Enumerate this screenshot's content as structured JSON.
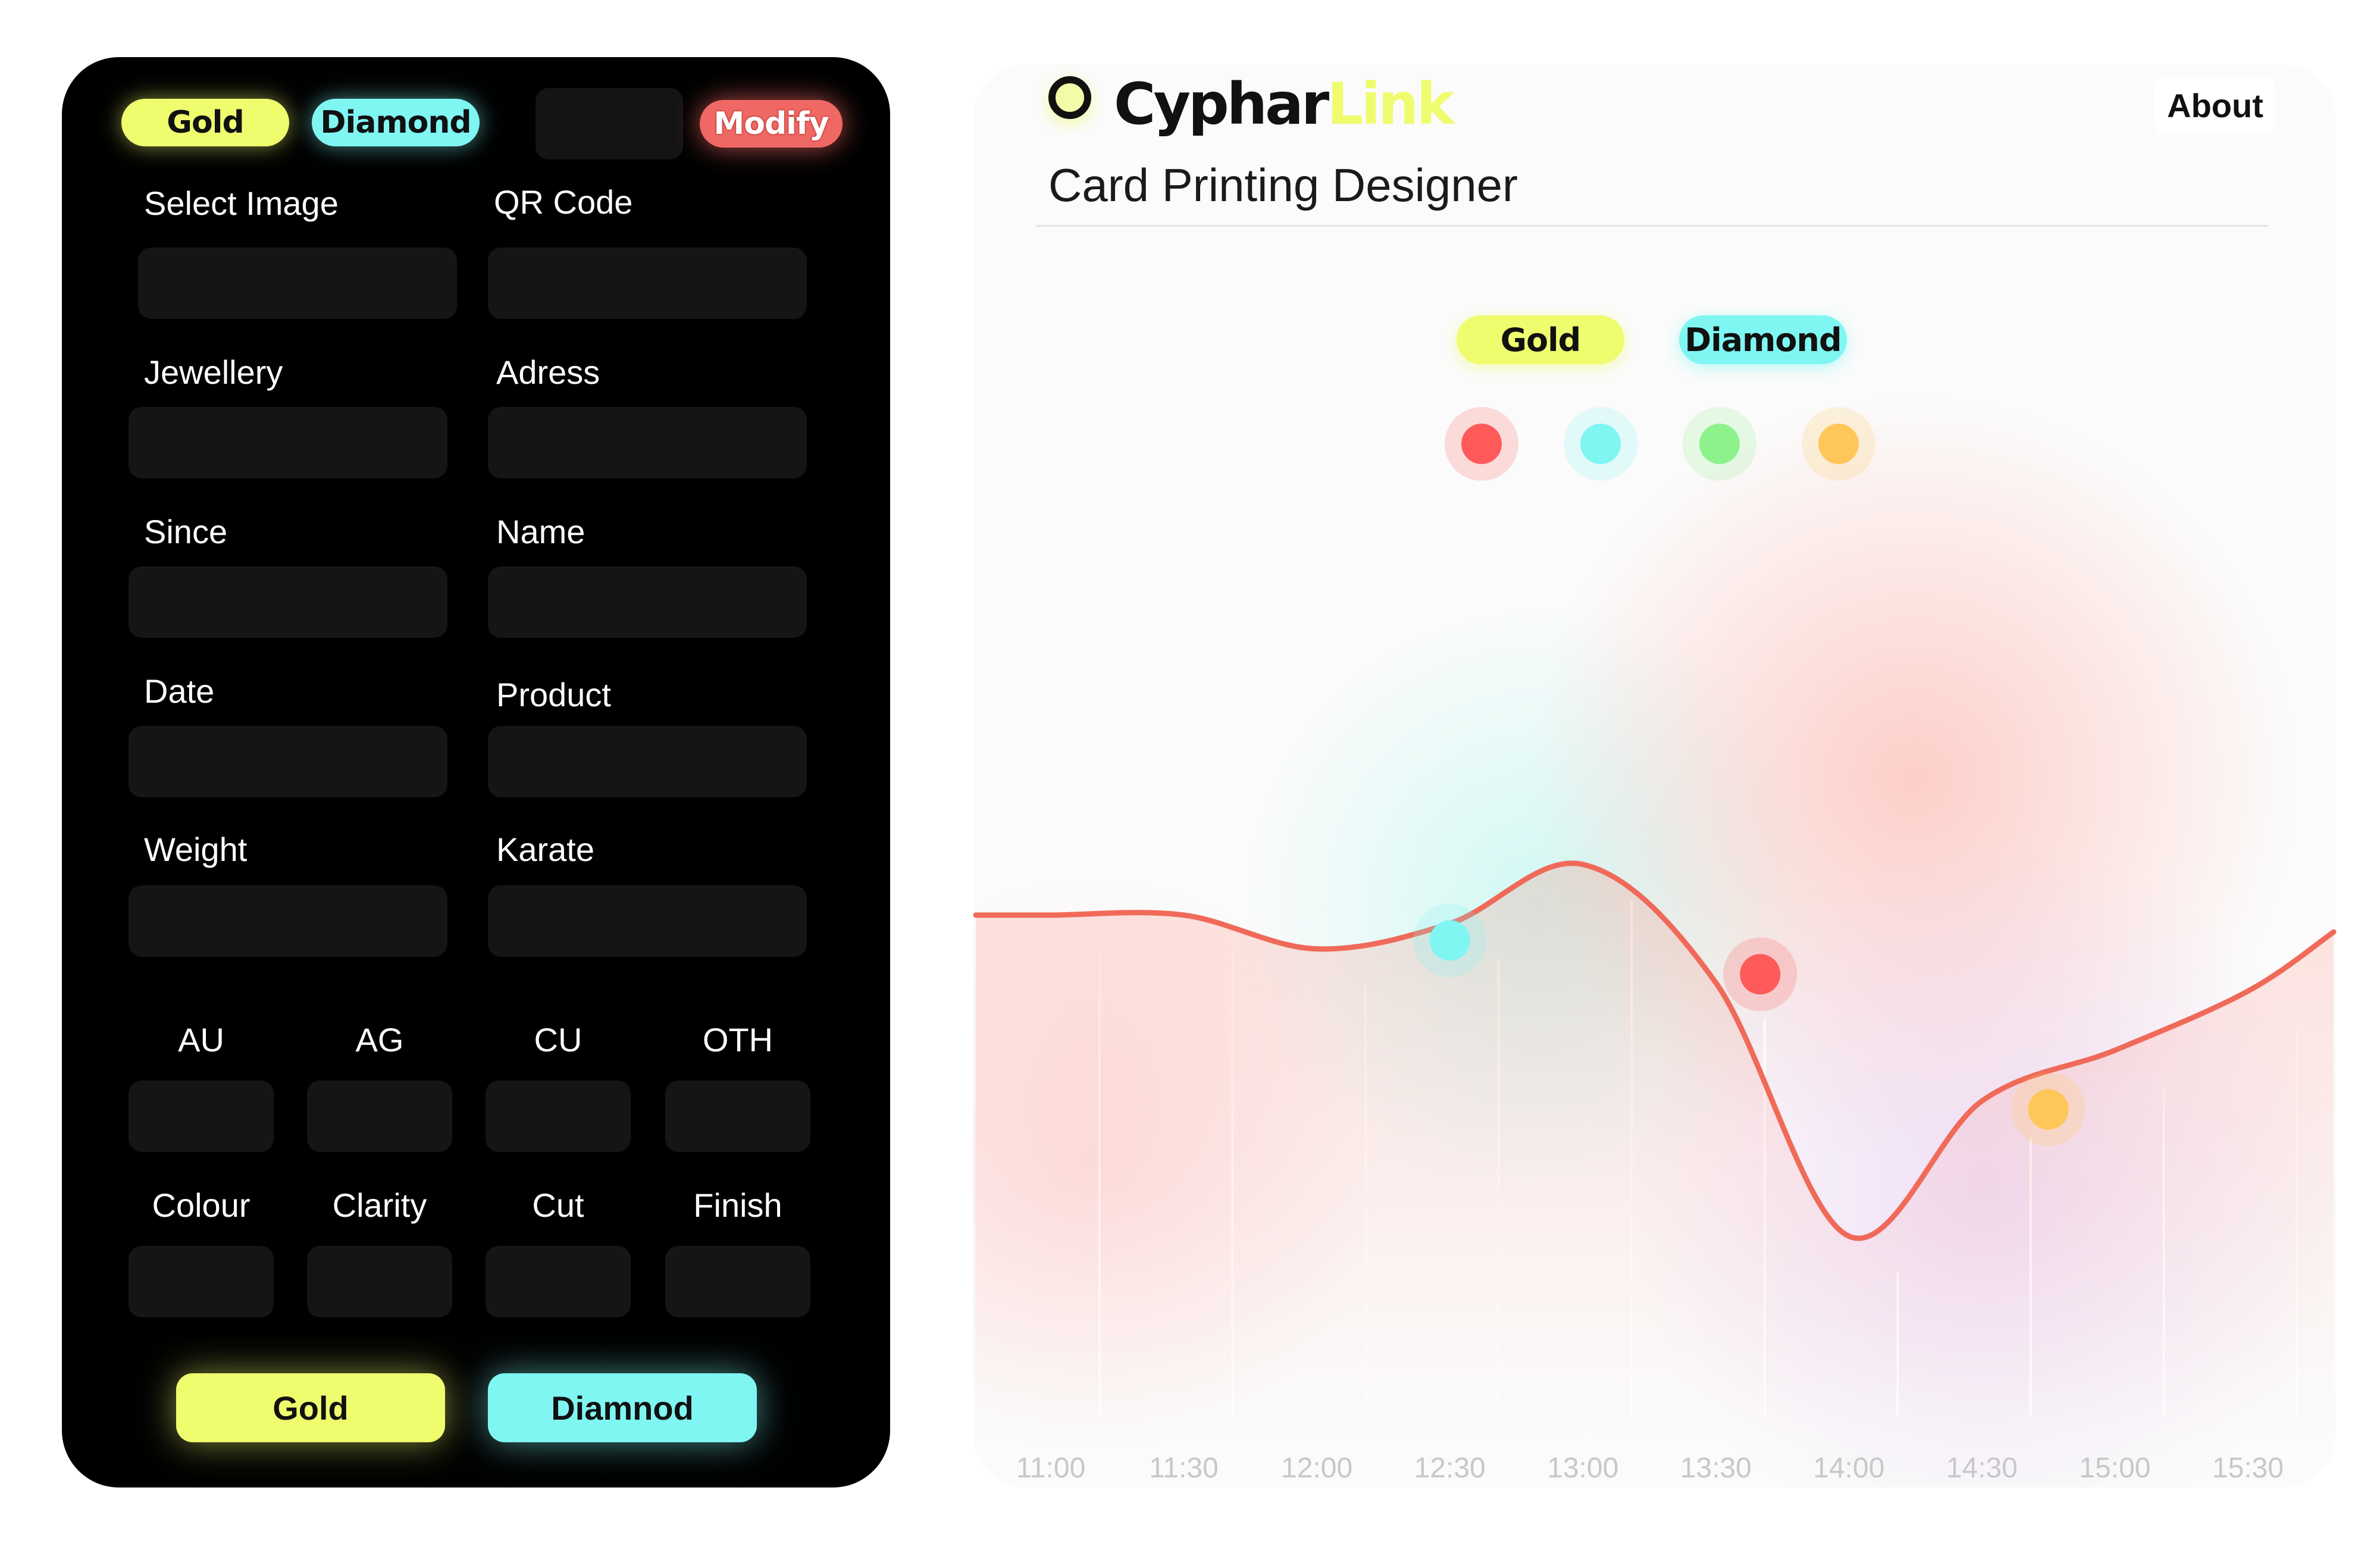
{
  "form": {
    "header": {
      "gold": "Gold",
      "diamond": "Diamond",
      "modify": "Modify"
    },
    "fields": {
      "select_image": "Select Image",
      "qr_code": "QR Code",
      "jewellery": "Jewellery",
      "adress": "Adress",
      "since": "Since",
      "name": "Name",
      "date": "Date",
      "product": "Product",
      "weight": "Weight",
      "karate": "Karate",
      "au": "AU",
      "ag": "AG",
      "cu": "CU",
      "oth": "OTH",
      "colour": "Colour",
      "clarity": "Clarity",
      "cut": "Cut",
      "finish": "Finish"
    },
    "buttons": {
      "gold": "Gold",
      "diamond": "Diamnod"
    }
  },
  "dashboard": {
    "logo": {
      "part1": "Cyphar",
      "part2": "Link"
    },
    "about": "About",
    "subtitle": "Card Printing Designer",
    "legend": {
      "gold": "Gold",
      "diamond": "Diamond"
    },
    "dots": [
      "#ff5a5a",
      "#7ff6f2",
      "#8ef28c",
      "#ffc75a"
    ]
  },
  "colors": {
    "gold": "#eefc6e",
    "diamond": "#7ff6f2",
    "modify": "#f06864",
    "line": "#f06a5a"
  },
  "chart_data": {
    "type": "line",
    "x": [
      "11:00",
      "11:30",
      "12:00",
      "12:30",
      "13:00",
      "13:30",
      "14:00",
      "14:30",
      "15:00",
      "15:30"
    ],
    "series": [
      {
        "values": [
          6.0,
          6.0,
          5.6,
          5.9,
          6.6,
          5.2,
          2.2,
          3.8,
          4.4,
          5.1
        ]
      }
    ],
    "markers": [
      {
        "x": "12:30",
        "y": 5.7,
        "color": "#7ff6f2"
      },
      {
        "x": "13:40",
        "y": 5.3,
        "color": "#ff5a5a"
      },
      {
        "x": "14:45",
        "y": 3.7,
        "color": "#ffc75a"
      }
    ]
  }
}
